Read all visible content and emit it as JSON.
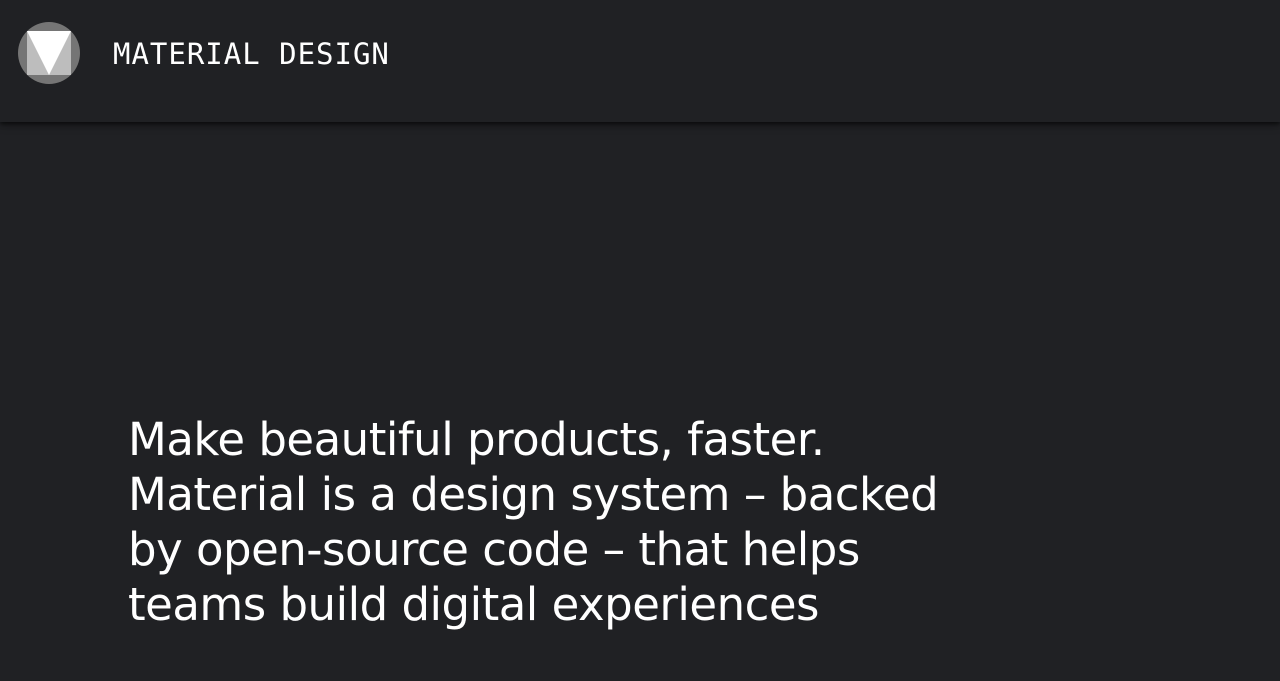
{
  "header": {
    "brand": "MATERIAL DESIGN",
    "logo_icon": "material-design-logo-icon",
    "colors": {
      "background": "#202124",
      "logo_circle": "#757575",
      "logo_square": "#bdbdbd",
      "logo_triangle": "#ffffff"
    }
  },
  "hero": {
    "headline_lines": [
      "Make beautiful products, faster.",
      "Material is a design system – backed",
      "by open-source code – that helps",
      "teams build digital experiences"
    ],
    "text_color": "#ffffff"
  }
}
